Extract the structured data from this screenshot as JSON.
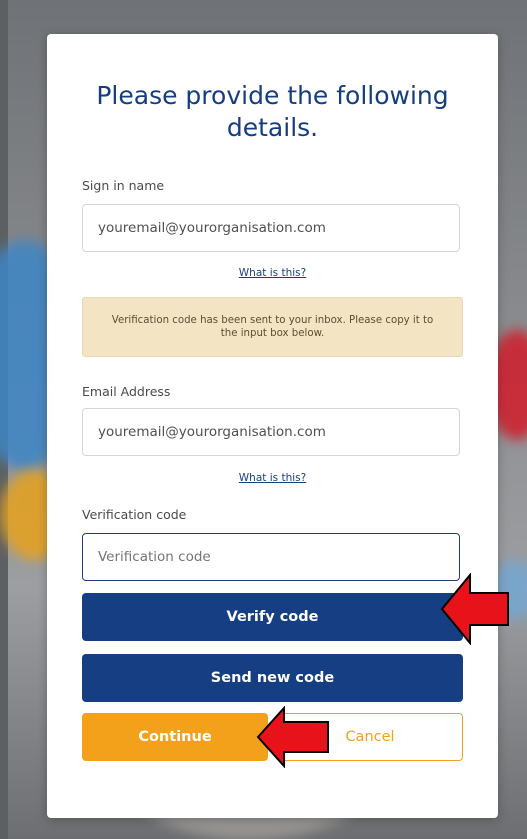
{
  "form": {
    "title": "Please provide the following details.",
    "sign_in_name": {
      "label": "Sign in name",
      "value": "youremail@yourorganisation.com",
      "help_link": "What is this?"
    },
    "info_message": "Verification code has been sent to your inbox. Please copy it to the input box below.",
    "email_address": {
      "label": "Email Address",
      "value": "youremail@yourorganisation.com",
      "help_link": "What is this?"
    },
    "verification_code": {
      "label": "Verification code",
      "placeholder": "Verification code"
    },
    "buttons": {
      "verify": "Verify code",
      "send_new": "Send new code",
      "continue": "Continue",
      "cancel": "Cancel"
    }
  },
  "colors": {
    "primary": "#153e83",
    "accent": "#f3a11a",
    "annotation_arrow": "#e8121b"
  }
}
